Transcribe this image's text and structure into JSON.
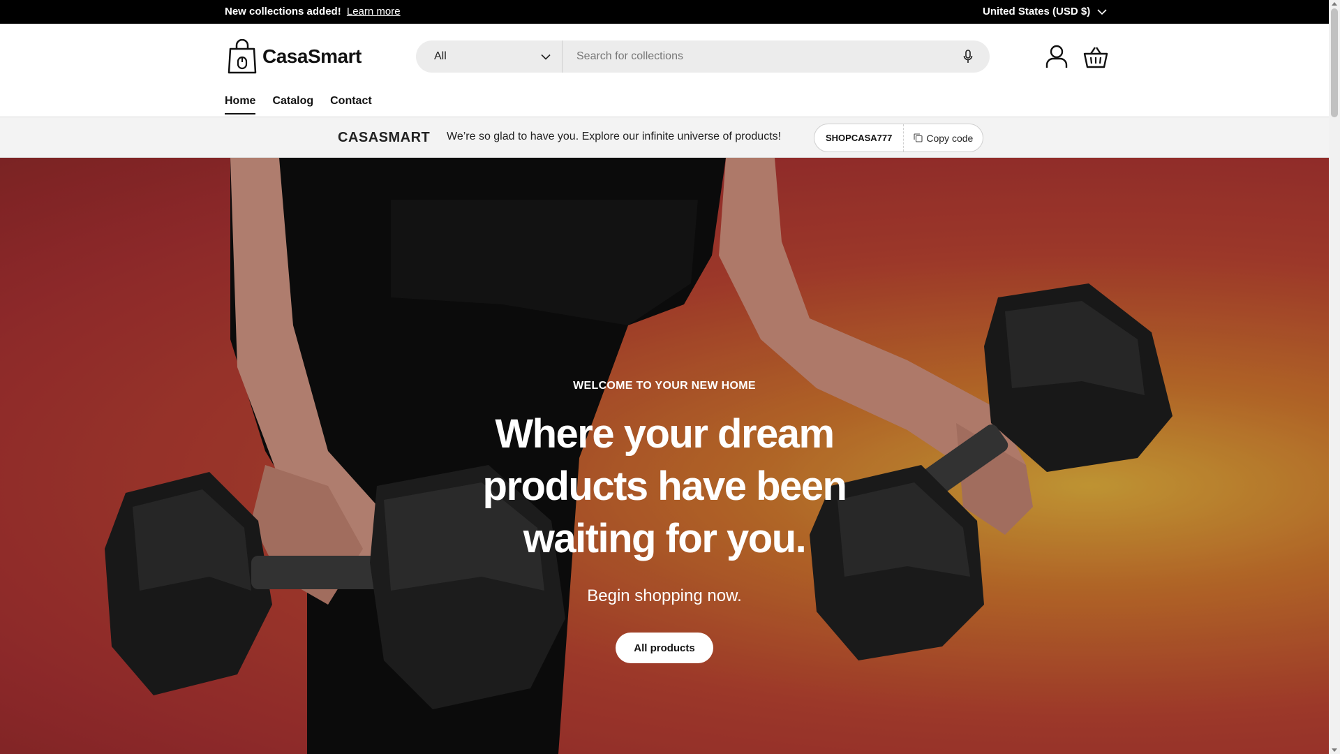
{
  "announcement": {
    "message": "New collections added!",
    "link_label": "Learn more",
    "country_label": "United States (USD $)"
  },
  "header": {
    "logo_text": "CasaSmart",
    "search": {
      "category_label": "All",
      "placeholder": "Search for collections"
    },
    "icons": [
      "shopping-bag-logo-icon",
      "chevron-down-icon",
      "microphone-icon",
      "account-icon",
      "cart-icon"
    ],
    "nav": [
      {
        "label": "Home",
        "active": true
      },
      {
        "label": "Catalog",
        "active": false
      },
      {
        "label": "Contact",
        "active": false
      }
    ]
  },
  "promo": {
    "brand": "CASASMART",
    "text": "We’re so glad to have you. Explore our infinite universe of products!",
    "code": "SHOPCASA777",
    "copy_label": "Copy code"
  },
  "hero": {
    "eyebrow": "WELCOME TO YOUR NEW HOME",
    "title": "Where your dream products have been waiting for you.",
    "subtitle": "Begin shopping now.",
    "button_label": "All products",
    "colors": {
      "bg_red": "#a8322f",
      "bg_orange": "#c8722c",
      "bg_yellow": "#d9a83a"
    }
  }
}
